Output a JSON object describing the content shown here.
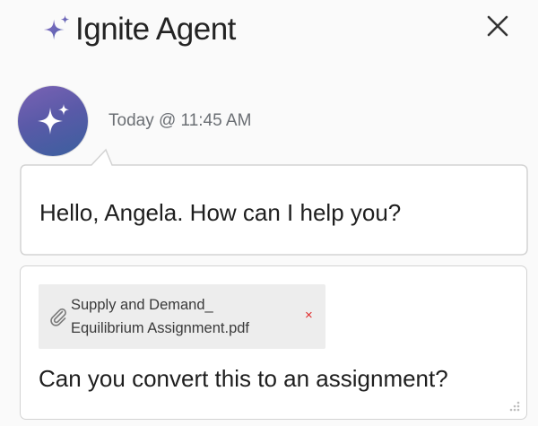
{
  "header": {
    "title": "Ignite Agent",
    "sparkle_icon": "sparkle-icon",
    "close_icon": "close-icon"
  },
  "message": {
    "timestamp": "Today @ 11:45 AM",
    "text": "Hello, Angela. How can I help you?",
    "avatar_icon": "sparkle-icon"
  },
  "composer": {
    "attachment": {
      "file_name_line1": "Supply and Demand_",
      "file_name_line2": "Equilibrium Assignment.pdf",
      "clip_icon": "paperclip-icon",
      "remove_label": "×"
    },
    "text": "Can you convert this to an assignment?",
    "resize_icon": "resize-handle-icon"
  },
  "colors": {
    "brand_purple_start": "#7a62b4",
    "brand_blue_end": "#3b5f9e",
    "remove_red": "#e02a2a",
    "timestamp_gray": "#6b6f74"
  }
}
